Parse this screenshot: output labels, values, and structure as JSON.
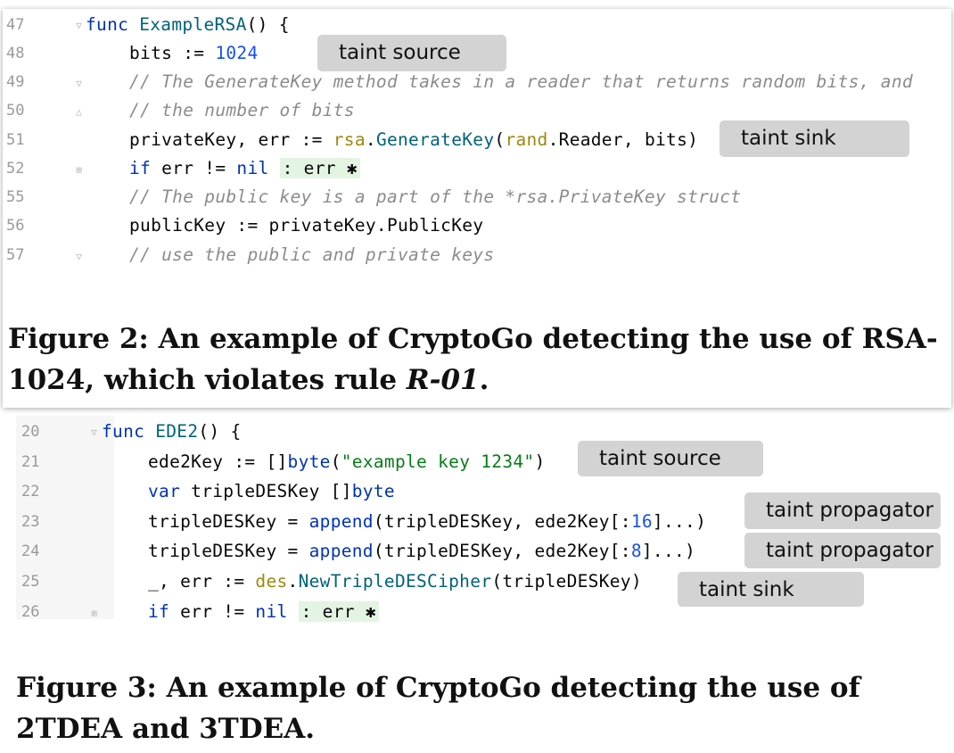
{
  "figure2": {
    "lines": [
      {
        "num": "47",
        "code": "func ExampleRSA() {"
      },
      {
        "num": "48",
        "code": "bits := 1024"
      },
      {
        "num": "49",
        "code": "// The GenerateKey method takes in a reader that returns random bits, and"
      },
      {
        "num": "50",
        "code": "// the number of bits"
      },
      {
        "num": "51",
        "code": "privateKey, err := rsa.GenerateKey(rand.Reader, bits)"
      },
      {
        "num": "52",
        "code": "if err != nil : err ✱"
      },
      {
        "num": "55",
        "code": "// The public key is a part of the *rsa.PrivateKey struct"
      },
      {
        "num": "56",
        "code": "publicKey := privateKey.PublicKey"
      },
      {
        "num": "57",
        "code": "// use the public and private keys"
      }
    ],
    "tags": {
      "source": "taint source",
      "sink": "taint sink"
    },
    "caption_main": "Figure 2: An example of CryptoGo detecting the use of RSA-1024, which violates rule ",
    "caption_rule": "R-01",
    "caption_end": "."
  },
  "figure3": {
    "lines": [
      {
        "num": "20",
        "code": "func EDE2() {"
      },
      {
        "num": "21",
        "code": "ede2Key := []byte(\"example key 1234\")"
      },
      {
        "num": "22",
        "code": "var tripleDESKey []byte"
      },
      {
        "num": "23",
        "code": "tripleDESKey = append(tripleDESKey, ede2Key[:16]...)"
      },
      {
        "num": "24",
        "code": "tripleDESKey = append(tripleDESKey, ede2Key[:8]...)"
      },
      {
        "num": "25",
        "code": "_, err := des.NewTripleDESCipher(tripleDESKey)"
      },
      {
        "num": "26",
        "code": "if err != nil : err ✱"
      }
    ],
    "tags": {
      "source": "taint source",
      "propagator1": "taint propagator",
      "propagator2": "taint propagator",
      "sink": "taint sink"
    },
    "caption": "Figure 3: An example of CryptoGo detecting the use of 2TDEA and 3TDEA."
  },
  "colors": {
    "keyword": "#0033b3",
    "number": "#1750eb",
    "comment": "#8c8c8c",
    "package": "#9e880d",
    "function": "#00627a",
    "string": "#067d17",
    "tag_bg": "#d3d3d3"
  }
}
